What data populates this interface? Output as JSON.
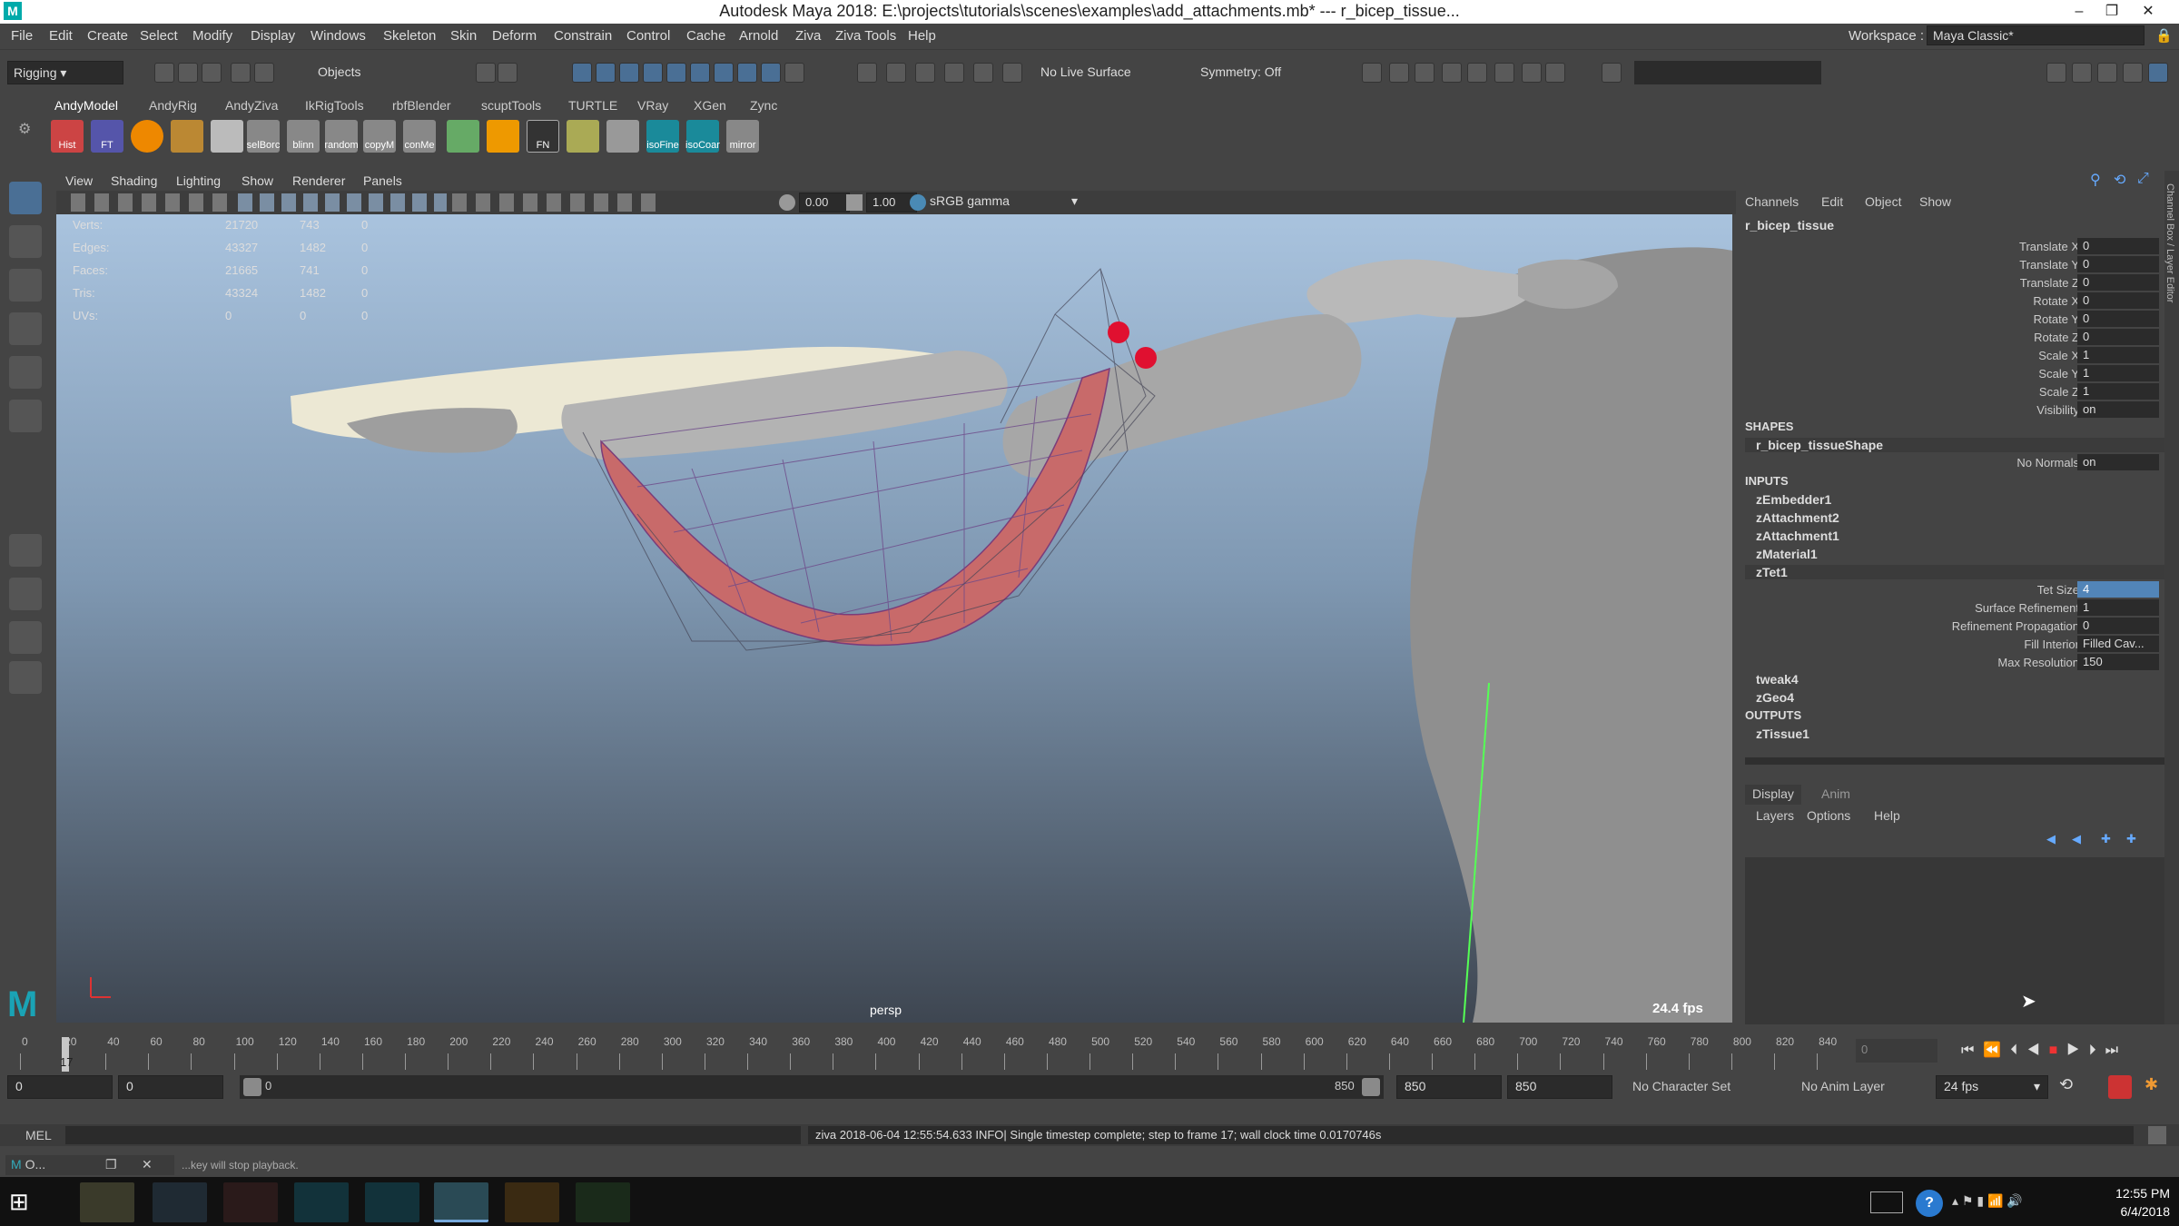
{
  "window": {
    "title": "Autodesk Maya 2018: E:\\projects\\tutorials\\scenes\\examples\\add_attachments.mb*  ---  r_bicep_tissue..."
  },
  "menus": [
    "File",
    "Edit",
    "Create",
    "Select",
    "Modify",
    "Display",
    "Windows",
    "Skeleton",
    "Skin",
    "Deform",
    "Constrain",
    "Control",
    "Cache",
    "Arnold",
    "Ziva",
    "Ziva Tools",
    "Help"
  ],
  "workspace": {
    "label": "Workspace :",
    "value": "Maya Classic*"
  },
  "statusline": {
    "menuset": "Rigging",
    "objects": "Objects",
    "live_surface": "No Live Surface",
    "symmetry": "Symmetry: Off"
  },
  "shelf_tabs": [
    "AndyModel",
    "AndyRig",
    "AndyZiva",
    "IkRigTools",
    "rbfBlender",
    "scuptTools",
    "TURTLE",
    "VRay",
    "XGen",
    "Zync"
  ],
  "shelf_labels": [
    "Hist",
    "FT",
    "",
    "",
    "",
    "selBorc",
    "blinn",
    "random",
    "copyM",
    "conMe",
    "",
    "",
    "FN",
    "",
    "",
    "isoFine",
    "isoCoar",
    "mirror"
  ],
  "viewport": {
    "menus": [
      "View",
      "Shading",
      "Lighting",
      "Show",
      "Renderer",
      "Panels"
    ],
    "exposure": "0.00",
    "gamma": "1.00",
    "colorspace": "sRGB gamma",
    "camera": "persp",
    "fps": "24.4 fps",
    "stats": [
      {
        "label": "Verts:",
        "v1": "21720",
        "v2": "743",
        "v3": "0"
      },
      {
        "label": "Edges:",
        "v1": "43327",
        "v2": "1482",
        "v3": "0"
      },
      {
        "label": "Faces:",
        "v1": "21665",
        "v2": "741",
        "v3": "0"
      },
      {
        "label": "Tris:",
        "v1": "43324",
        "v2": "1482",
        "v3": "0"
      },
      {
        "label": "UVs:",
        "v1": "0",
        "v2": "0",
        "v3": "0"
      }
    ]
  },
  "channelbox": {
    "menus": [
      "Channels",
      "Edit",
      "Object",
      "Show"
    ],
    "object": "r_bicep_tissue",
    "channels": [
      {
        "label": "Translate X",
        "value": "0"
      },
      {
        "label": "Translate Y",
        "value": "0"
      },
      {
        "label": "Translate Z",
        "value": "0"
      },
      {
        "label": "Rotate X",
        "value": "0"
      },
      {
        "label": "Rotate Y",
        "value": "0"
      },
      {
        "label": "Rotate Z",
        "value": "0"
      },
      {
        "label": "Scale X",
        "value": "1"
      },
      {
        "label": "Scale Y",
        "value": "1"
      },
      {
        "label": "Scale Z",
        "value": "1"
      },
      {
        "label": "Visibility",
        "value": "on"
      }
    ],
    "shapes_header": "SHAPES",
    "shape": "r_bicep_tissueShape",
    "no_normals_label": "No Normals",
    "no_normals_value": "on",
    "inputs_header": "INPUTS",
    "inputs": [
      "zEmbedder1",
      "zAttachment2",
      "zAttachment1",
      "zMaterial1",
      "zTet1"
    ],
    "tet_attrs": [
      {
        "label": "Tet Size",
        "value": "4"
      },
      {
        "label": "Surface Refinement",
        "value": "1"
      },
      {
        "label": "Refinement Propagation",
        "value": "0"
      },
      {
        "label": "Fill Interior",
        "value": "Filled Cav..."
      },
      {
        "label": "Max Resolution",
        "value": "150"
      }
    ],
    "more_inputs": [
      "tweak4",
      "zGeo4"
    ],
    "outputs_header": "OUTPUTS",
    "outputs": [
      "zTissue1"
    ],
    "side_tabs": "Channel Box / Layer Editor"
  },
  "layer_editor": {
    "tabs": [
      "Display",
      "Anim"
    ],
    "menus": [
      "Layers",
      "Options",
      "Help"
    ]
  },
  "timeline": {
    "ticks": [
      "0",
      "20",
      "40",
      "60",
      "80",
      "100",
      "120",
      "140",
      "160",
      "180",
      "200",
      "220",
      "240",
      "260",
      "280",
      "300",
      "320",
      "340",
      "360",
      "380",
      "400",
      "420",
      "440",
      "460",
      "480",
      "500",
      "520",
      "540",
      "560",
      "580",
      "600",
      "620",
      "640",
      "660",
      "680",
      "700",
      "720",
      "740",
      "760",
      "780",
      "800",
      "820",
      "840"
    ],
    "current": "17",
    "frame_field": "0"
  },
  "range": {
    "start": "0",
    "inner_start": "0",
    "slider_start": "0",
    "slider_end": "850",
    "end": "850",
    "end2": "850",
    "character_set": "No Character Set",
    "anim_layer": "No Anim Layer",
    "fps": "24 fps"
  },
  "mel": {
    "label": "MEL",
    "output": "ziva 2018-06-04 12:55:54.633 INFO| Single timestep complete; step to frame 17; wall clock time 0.0170746s"
  },
  "helpline": {
    "text": "...key will stop playback.",
    "mini": "O..."
  },
  "taskbar": {
    "time": "12:55 PM",
    "date": "6/4/2018"
  }
}
